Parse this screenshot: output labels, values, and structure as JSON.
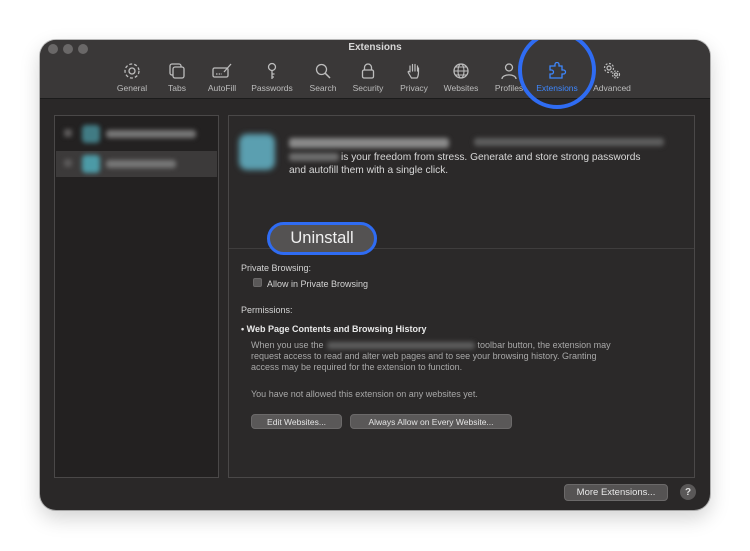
{
  "window": {
    "title": "Extensions"
  },
  "toolbar": [
    {
      "label": "General",
      "icon": "gear-icon"
    },
    {
      "label": "Tabs",
      "icon": "tabs-icon"
    },
    {
      "label": "AutoFill",
      "icon": "autofill-icon"
    },
    {
      "label": "Passwords",
      "icon": "key-icon"
    },
    {
      "label": "Search",
      "icon": "search-icon"
    },
    {
      "label": "Security",
      "icon": "lock-icon"
    },
    {
      "label": "Privacy",
      "icon": "hand-icon"
    },
    {
      "label": "Websites",
      "icon": "globe-icon"
    },
    {
      "label": "Profiles",
      "icon": "person-icon"
    },
    {
      "label": "Extensions",
      "icon": "puzzle-icon",
      "active": true
    },
    {
      "label": "Advanced",
      "icon": "gears-icon"
    }
  ],
  "accent_color": "#2f6cf3",
  "extension": {
    "description_line1": "is your freedom from stress. Generate and store strong passwords",
    "description_line2": "and autofill them with a single click.",
    "uninstall_label": "Uninstall"
  },
  "private_browsing": {
    "heading": "Private Browsing:",
    "checkbox_label": "Allow in Private Browsing",
    "checked": false
  },
  "permissions": {
    "heading": "Permissions:",
    "item_title": "Web Page Contents and Browsing History",
    "text_before": "When you use the",
    "text_after_line1": "toolbar button, the extension may",
    "text_line2": "request access to read and alter web pages and to see your browsing history. Granting",
    "text_line3": "access may be required for the extension to function.",
    "not_allowed": "You have not allowed this extension on any websites yet.",
    "edit_button": "Edit Websites...",
    "always_allow_button": "Always Allow on Every Website..."
  },
  "footer": {
    "more_extensions": "More Extensions...",
    "help": "?"
  }
}
